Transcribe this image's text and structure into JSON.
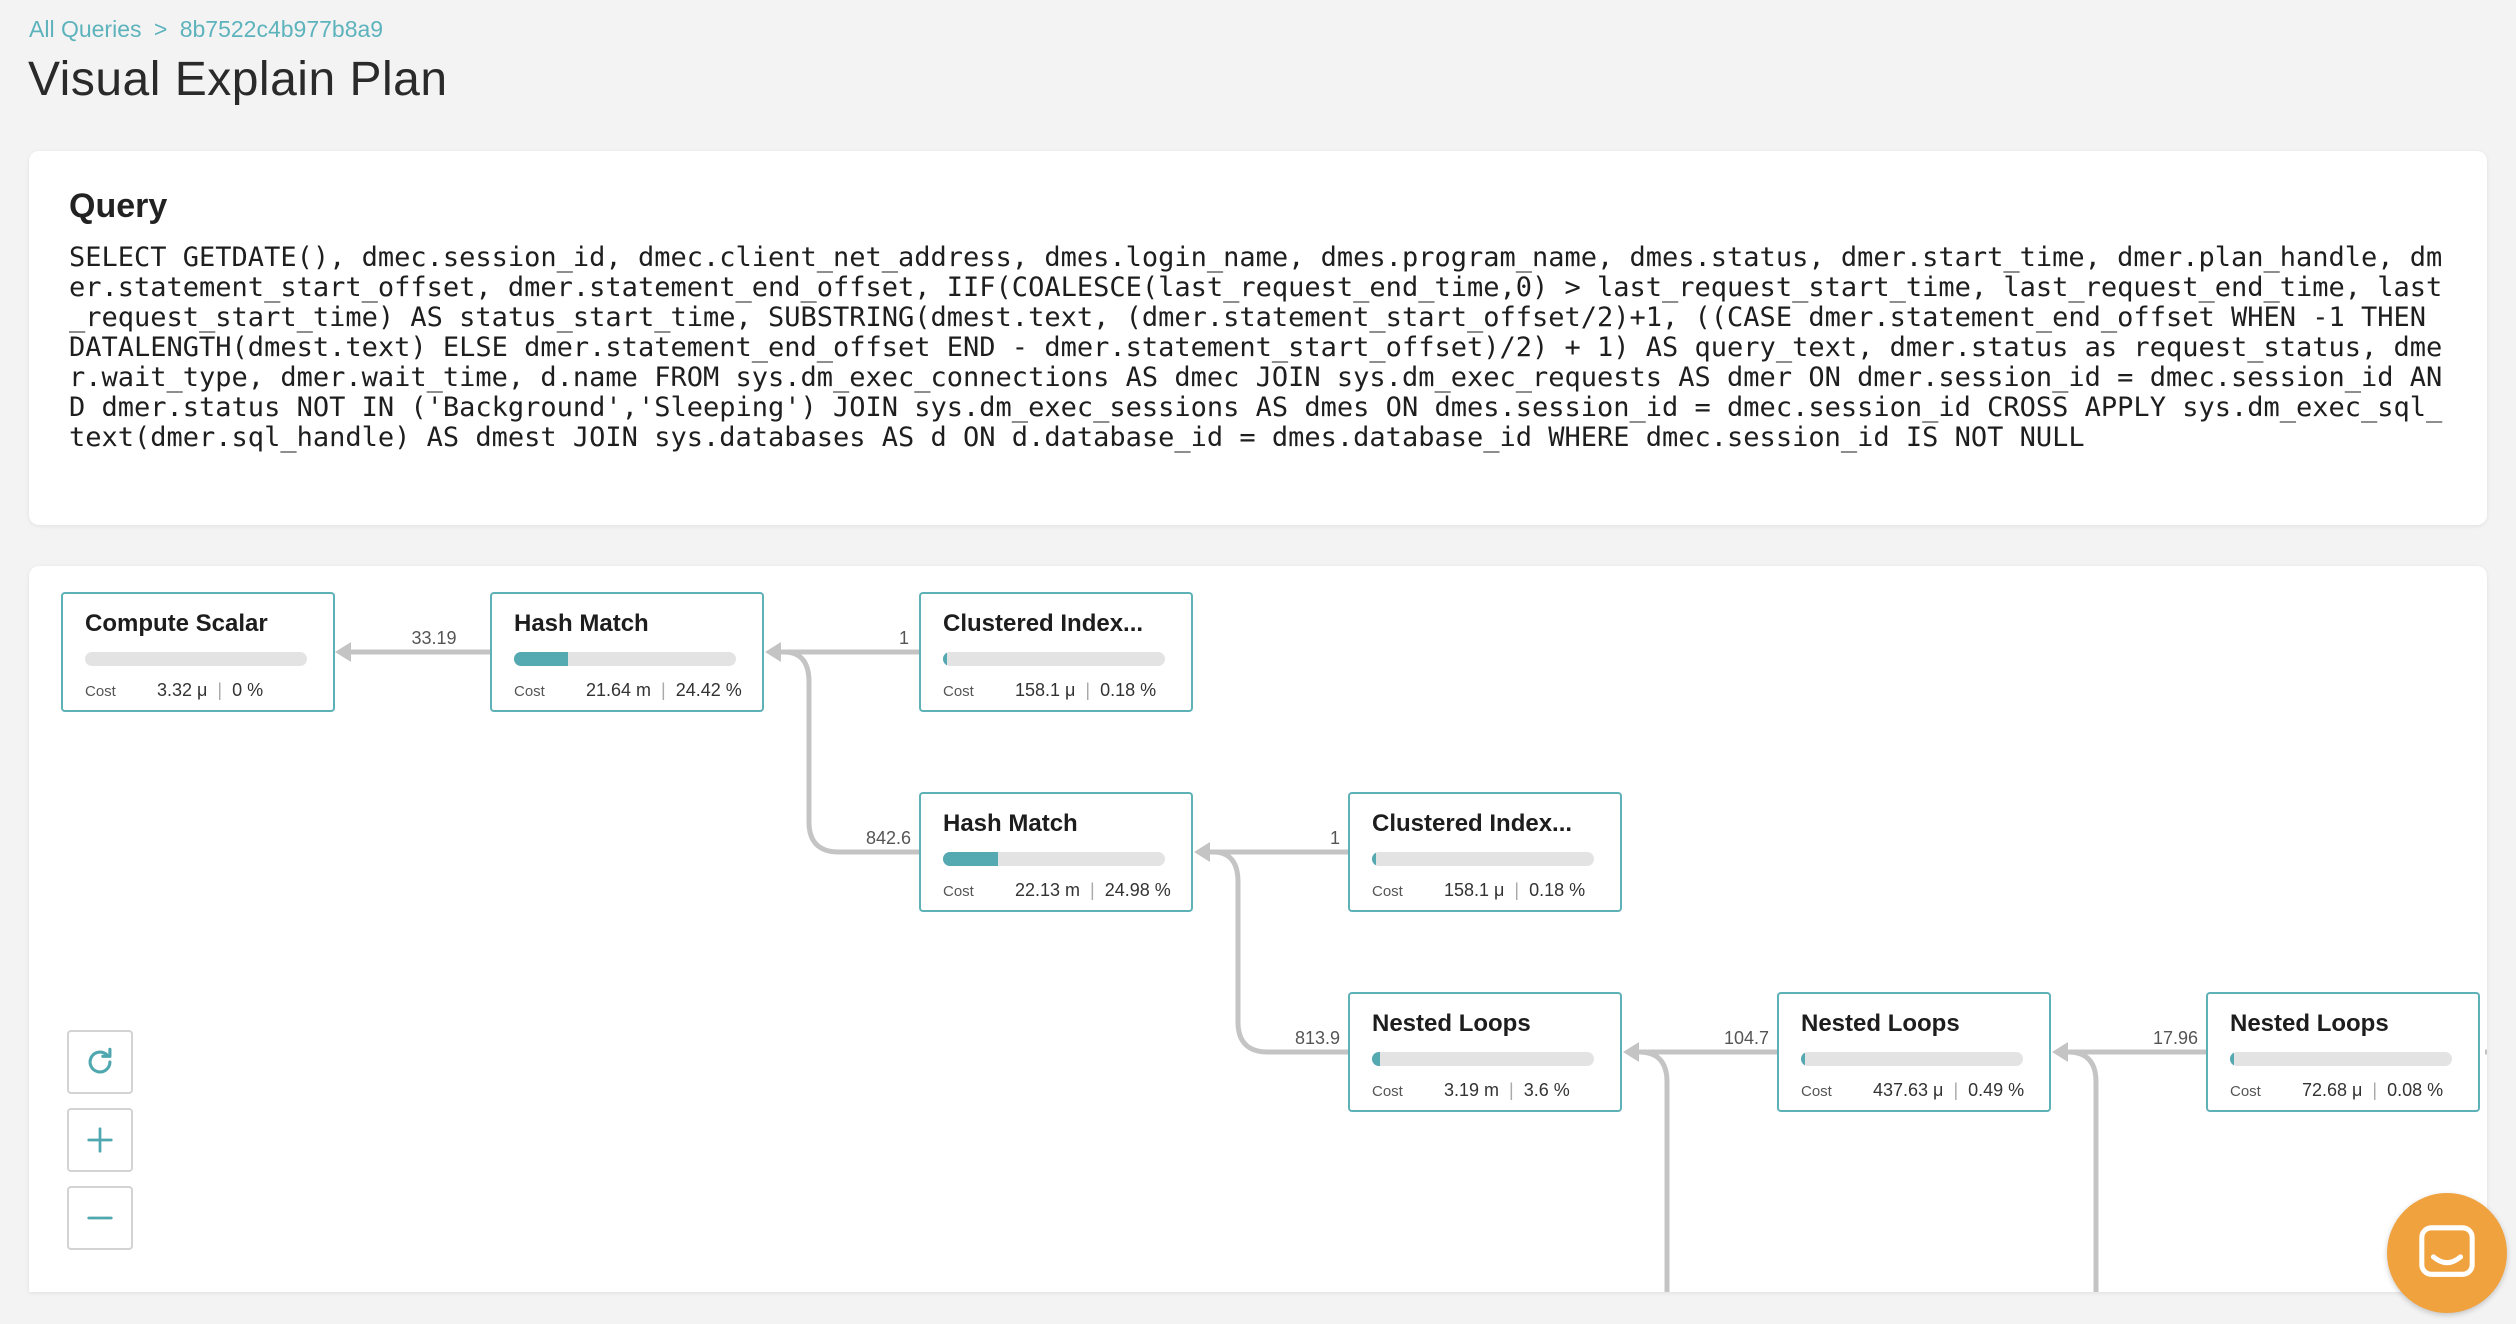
{
  "breadcrumb": {
    "root": "All Queries",
    "separator": ">",
    "current": "8b7522c4b977b8a9"
  },
  "page_title": "Visual Explain Plan",
  "query": {
    "heading": "Query",
    "text": "SELECT GETDATE(), dmec.session_id, dmec.client_net_address, dmes.login_name, dmes.program_name, dmes.status, dmer.start_time, dmer.plan_handle, dmer.statement_start_offset, dmer.statement_end_offset, IIF(COALESCE(last_request_end_time,0) > last_request_start_time, last_request_end_time, last_request_start_time) AS status_start_time, SUBSTRING(dmest.text, (dmer.statement_start_offset/2)+1, ((CASE dmer.statement_end_offset WHEN -1 THEN DATALENGTH(dmest.text) ELSE dmer.statement_end_offset END - dmer.statement_start_offset)/2) + 1) AS query_text, dmer.status as request_status, dmer.wait_type, dmer.wait_time, d.name FROM sys.dm_exec_connections AS dmec JOIN sys.dm_exec_requests AS dmer ON dmer.session_id = dmec.session_id AND dmer.status NOT IN ('Background','Sleeping') JOIN sys.dm_exec_sessions AS dmes ON dmes.session_id = dmec.session_id CROSS APPLY sys.dm_exec_sql_text(dmer.sql_handle) AS dmest JOIN sys.databases AS d ON d.database_id = dmes.database_id WHERE dmec.session_id IS NOT NULL"
  },
  "plan": {
    "cost_label": "Cost",
    "nodes": [
      {
        "id": "compute-scalar",
        "title": "Compute Scalar",
        "cost": "3.32 μ",
        "percent": "0 %",
        "fill": 0.0
      },
      {
        "id": "hash-match-1",
        "title": "Hash Match",
        "cost": "21.64 m",
        "percent": "24.42 %",
        "fill": 0.2442
      },
      {
        "id": "clustered-index-1",
        "title": "Clustered Index...",
        "cost": "158.1 μ",
        "percent": "0.18 %",
        "fill": 0.0018
      },
      {
        "id": "hash-match-2",
        "title": "Hash Match",
        "cost": "22.13 m",
        "percent": "24.98 %",
        "fill": 0.2498
      },
      {
        "id": "clustered-index-2",
        "title": "Clustered Index...",
        "cost": "158.1 μ",
        "percent": "0.18 %",
        "fill": 0.0018
      },
      {
        "id": "nested-loops-1",
        "title": "Nested Loops",
        "cost": "3.19 m",
        "percent": "3.6 %",
        "fill": 0.036
      },
      {
        "id": "nested-loops-2",
        "title": "Nested Loops",
        "cost": "437.63 μ",
        "percent": "0.49 %",
        "fill": 0.0049
      },
      {
        "id": "nested-loops-3",
        "title": "Nested Loops",
        "cost": "72.68 μ",
        "percent": "0.08 %",
        "fill": 0.0008
      }
    ],
    "edges": [
      {
        "label": "33.19"
      },
      {
        "label": "1"
      },
      {
        "label": "842.6"
      },
      {
        "label": "1"
      },
      {
        "label": "813.9"
      },
      {
        "label": "104.7"
      },
      {
        "label": "17.96"
      }
    ]
  },
  "zoom": {
    "reset_icon": "refresh-icon",
    "in_icon": "plus-icon",
    "out_icon": "minus-icon"
  },
  "chat": {
    "icon": "chat-icon",
    "color": "#f0a23f"
  },
  "colors": {
    "accent": "#5fb1b8",
    "link": "#5db3bc",
    "edge": "#c4c4c4"
  }
}
